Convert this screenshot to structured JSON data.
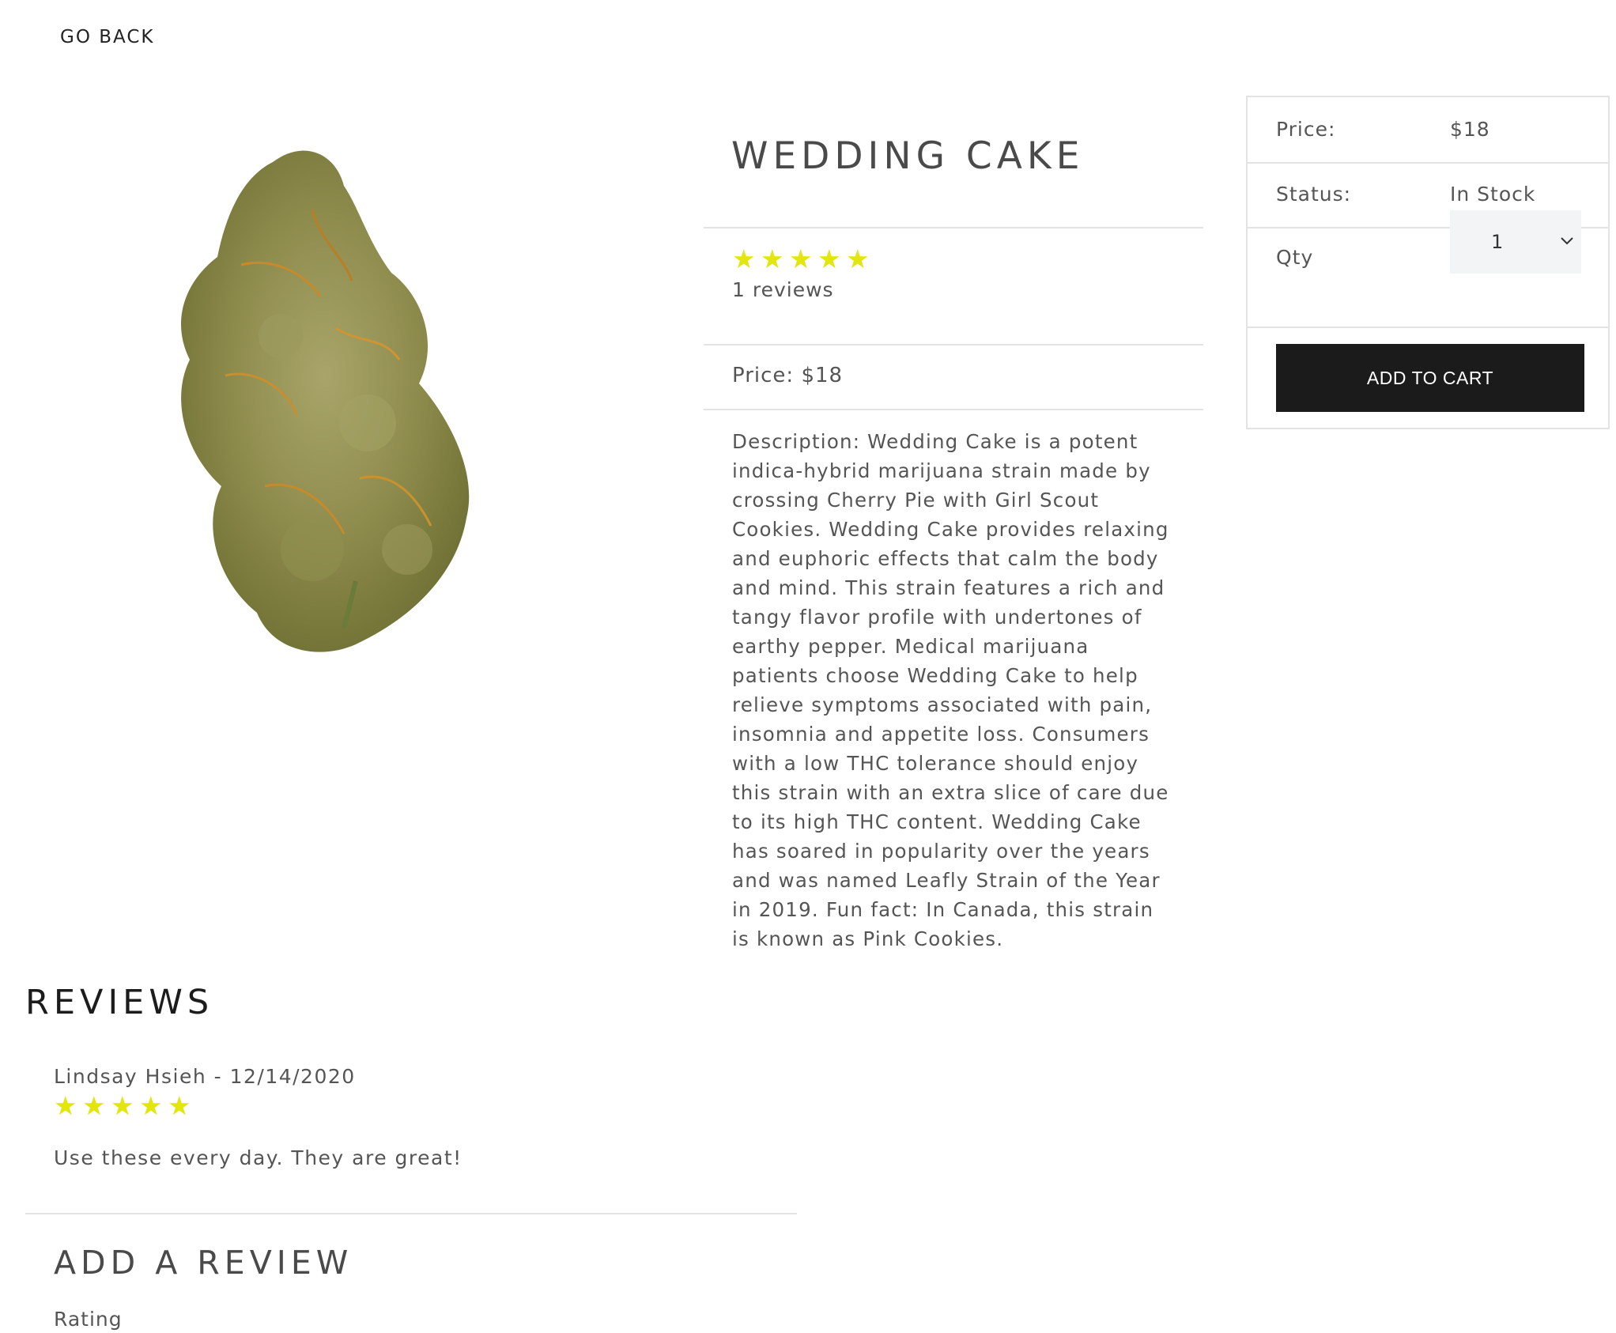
{
  "nav": {
    "go_back": "GO BACK"
  },
  "product": {
    "image_alt": "Wedding Cake",
    "title": "WEDDING CAKE",
    "rating": 5,
    "reviews_text": "1 reviews",
    "price_line": "Price: $18",
    "description": "Description: Wedding Cake is a potent indica-hybrid marijuana strain made by crossing Cherry Pie with Girl Scout Cookies. Wedding Cake provides relaxing and euphoric effects that calm the body and mind. This strain features a rich and tangy flavor profile with undertones of earthy pepper. Medical marijuana patients choose Wedding Cake to help relieve symptoms associated with pain, insomnia and appetite loss. Consumers with a low THC tolerance should enjoy this strain with an extra slice of care due to its high THC content. Wedding Cake has soared in popularity over the years and was named Leafly Strain of the Year in 2019. Fun fact: In Canada, this strain is known as Pink Cookies."
  },
  "cart": {
    "price_label": "Price:",
    "price_value": "$18",
    "status_label": "Status:",
    "status_value": "In Stock",
    "qty_label": "Qty",
    "qty_value": "1",
    "add_button": "ADD TO CART"
  },
  "reviews": {
    "title": "REVIEWS",
    "items": [
      {
        "meta": "Lindsay Hsieh - 12/14/2020",
        "rating": 5,
        "comment": "Use these every day. They are great!"
      }
    ]
  },
  "add_review": {
    "title": "ADD A REVIEW",
    "rating_label": "Rating"
  },
  "colors": {
    "star": "#e3e60c",
    "button_bg": "#1b1b1b",
    "divider": "#e3e3e3",
    "text": "#555555"
  }
}
